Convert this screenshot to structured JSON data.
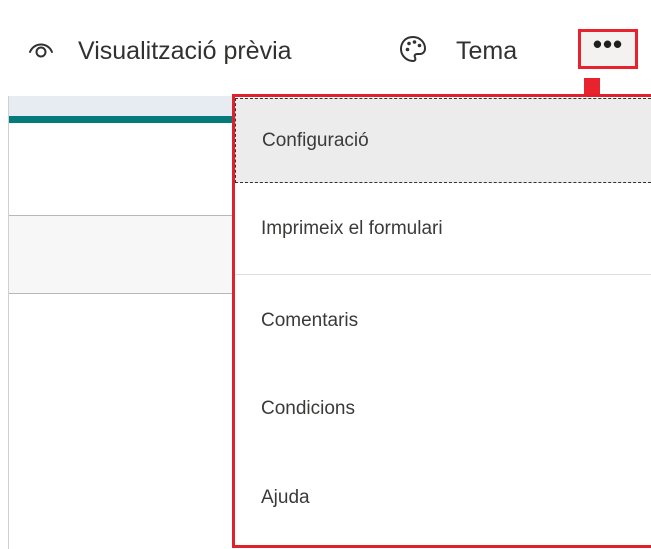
{
  "toolbar": {
    "preview": {
      "label": "Visualització prèvia",
      "icon": "eye-icon"
    },
    "theme": {
      "label": "Tema",
      "icon": "palette-icon"
    },
    "more": {
      "label": "•••",
      "icon": "more-options-icon"
    }
  },
  "menu": {
    "items": [
      {
        "label": "Configuració"
      },
      {
        "label": "Imprimeix el formulari"
      },
      {
        "label": "Comentaris"
      },
      {
        "label": "Condicions"
      },
      {
        "label": "Ajuda"
      }
    ]
  },
  "colors": {
    "highlight": "#e8232e",
    "teal_accent": "#047a7a",
    "selected_bg": "#ececec"
  }
}
